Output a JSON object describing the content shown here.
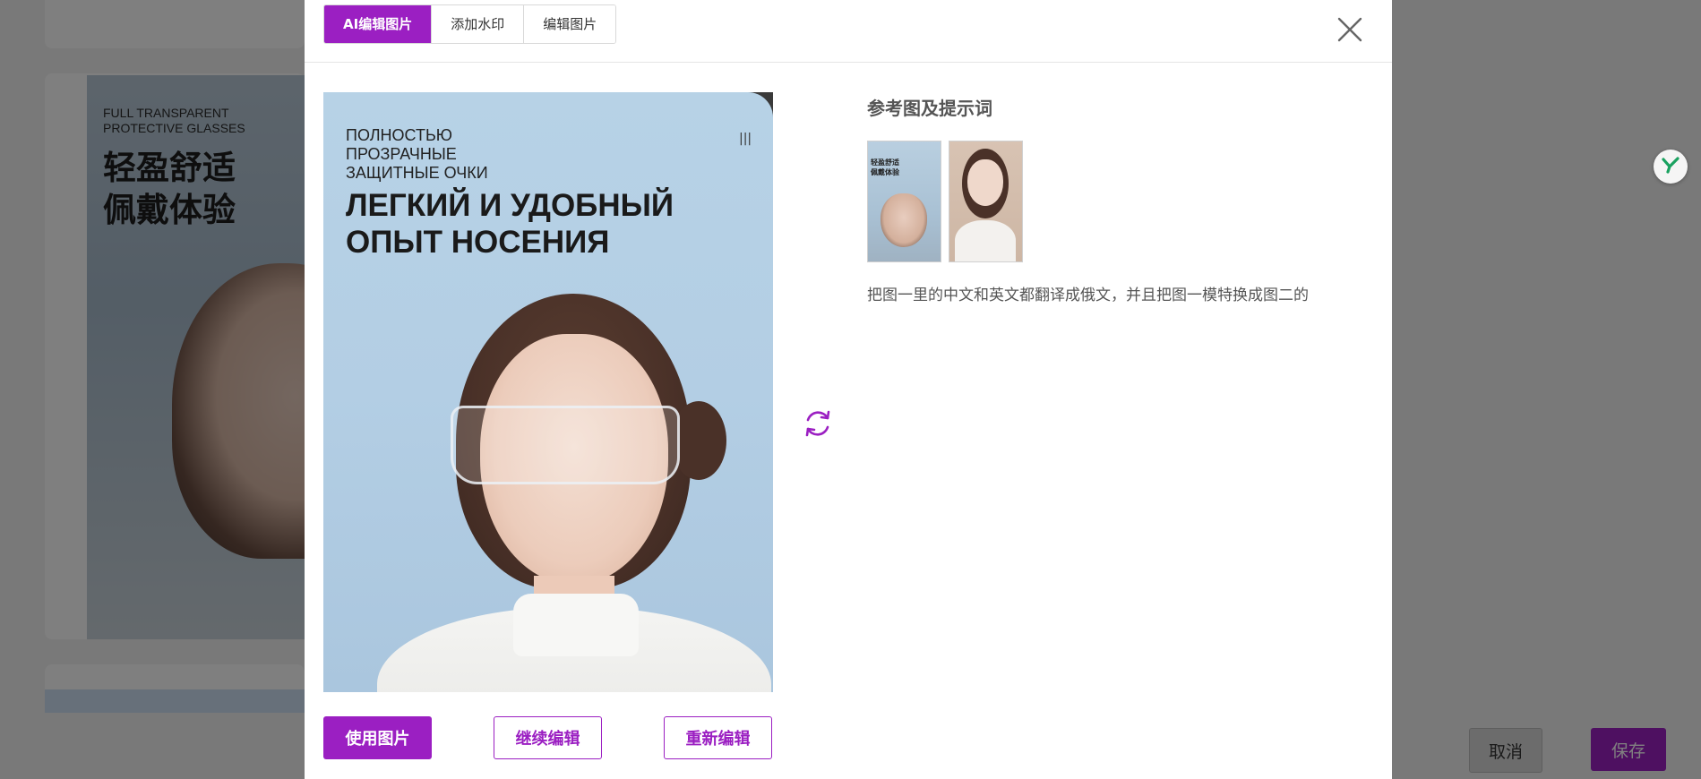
{
  "background": {
    "poster_en": "FULL TRANSPARENT PROTECTIVE GLASSES",
    "poster_zh_line1": "轻盈舒适",
    "poster_zh_line2": "佩戴体验",
    "cancel_label": "取消",
    "save_label": "保存"
  },
  "dialog": {
    "tabs": [
      {
        "label": "AI编辑图片",
        "active": true
      },
      {
        "label": "添加水印",
        "active": false
      },
      {
        "label": "编辑图片",
        "active": false
      }
    ],
    "result_poster": {
      "subtitle_line1": "ПОЛНОСТЬЮ",
      "subtitle_line2": "ПРОЗРАЧНЫЕ",
      "subtitle_line3": "ЗАЩИТНЫЕ ОЧКИ",
      "headline_line1": "ЛЕГКИЙ И УДОБНЫЙ",
      "headline_line2": "ОПЫТ НОСЕНИЯ",
      "corner_mark": "|||"
    },
    "buttons": {
      "use_image": "使用图片",
      "continue_edit": "继续编辑",
      "re_edit": "重新编辑"
    },
    "reference": {
      "title": "参考图及提示词",
      "thumb1_text_line1": "轻盈舒适",
      "thumb1_text_line2": "佩戴体验",
      "prompt": "把图一里的中文和英文都翻译成俄文，并且把图一模特换成图二的"
    }
  },
  "colors": {
    "accent": "#9b1fc2",
    "overlay": "rgba(0,0,0,0.5)"
  },
  "icons": {
    "close": "close-icon",
    "refresh": "refresh-icon",
    "side_badge": "y-logo-icon"
  }
}
